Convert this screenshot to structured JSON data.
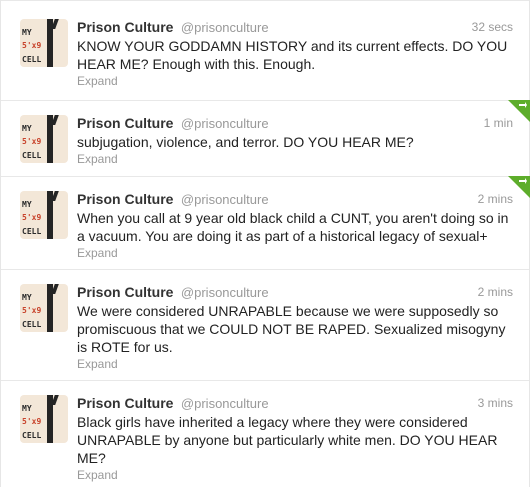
{
  "tweets": [
    {
      "fullname": "Prison Culture",
      "username": "@prisonculture",
      "time": "32 secs",
      "text": "KNOW YOUR GODDAMN HISTORY and its current effects. DO YOU HEAR ME? Enough with this. Enough.",
      "expand": "Expand",
      "avatar": {
        "line1": "MY",
        "line2": "5'x9",
        "line3": "CELL"
      },
      "retweeted": false
    },
    {
      "fullname": "Prison Culture",
      "username": "@prisonculture",
      "time": "1 min",
      "text": "subjugation, violence, and terror. DO YOU HEAR ME?",
      "expand": "Expand",
      "avatar": {
        "line1": "MY",
        "line2": "5'x9",
        "line3": "CELL"
      },
      "retweeted": true
    },
    {
      "fullname": "Prison Culture",
      "username": "@prisonculture",
      "time": "2 mins",
      "text": "When you call at 9 year old black child a CUNT, you aren't doing so in a vacuum. You are doing it as part of a historical legacy of sexual+",
      "expand": "Expand",
      "avatar": {
        "line1": "MY",
        "line2": "5'x9",
        "line3": "CELL"
      },
      "retweeted": true
    },
    {
      "fullname": "Prison Culture",
      "username": "@prisonculture",
      "time": "2 mins",
      "text": "We were considered UNRAPABLE because we were supposedly so promiscuous that we COULD NOT BE RAPED. Sexualized misogyny is ROTE for us.",
      "expand": "Expand",
      "avatar": {
        "line1": "MY",
        "line2": "5'x9",
        "line3": "CELL"
      },
      "retweeted": false
    },
    {
      "fullname": "Prison Culture",
      "username": "@prisonculture",
      "time": "3 mins",
      "text": "Black girls have inherited a legacy where they were considered UNRAPABLE by anyone but particularly white men. DO YOU HEAR ME?",
      "expand": "Expand",
      "avatar": {
        "line1": "MY",
        "line2": "5'x9",
        "line3": "CELL"
      },
      "retweeted": false
    }
  ],
  "colors": {
    "retweet_corner": "#5dad2b",
    "avatar_accent": "#c8432b"
  },
  "icons": {
    "retweet_corner": "retweet-corner-icon"
  }
}
